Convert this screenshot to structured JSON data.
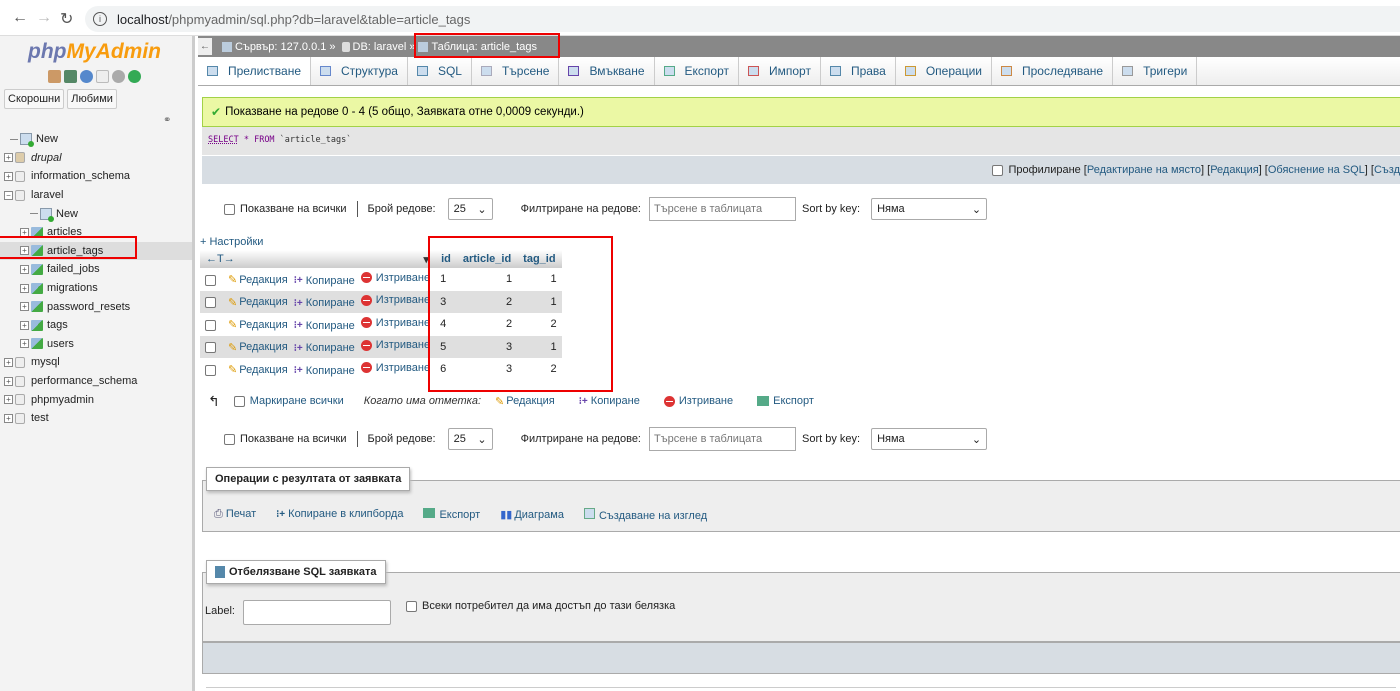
{
  "browser": {
    "url_host": "localhost",
    "url_path": "/phpmyadmin/sql.php?db=laravel&table=article_tags"
  },
  "sidebar": {
    "logo_php": "php",
    "logo_myadmin": "MyAdmin",
    "recent_button": "Скорошни",
    "favorites_button": "Любими",
    "tree": [
      {
        "label": "New",
        "type": "new",
        "level": 0
      },
      {
        "label": "drupal",
        "type": "db",
        "level": 0,
        "italic": true
      },
      {
        "label": "information_schema",
        "type": "db",
        "level": 0
      },
      {
        "label": "laravel",
        "type": "db",
        "level": 0,
        "expanded": true
      },
      {
        "label": "New",
        "type": "new",
        "level": 1
      },
      {
        "label": "articles",
        "type": "table",
        "level": 1
      },
      {
        "label": "article_tags",
        "type": "table",
        "level": 1,
        "selected": true
      },
      {
        "label": "failed_jobs",
        "type": "table",
        "level": 1
      },
      {
        "label": "migrations",
        "type": "table",
        "level": 1
      },
      {
        "label": "password_resets",
        "type": "table",
        "level": 1
      },
      {
        "label": "tags",
        "type": "table",
        "level": 1
      },
      {
        "label": "users",
        "type": "table",
        "level": 1
      },
      {
        "label": "mysql",
        "type": "db",
        "level": 0
      },
      {
        "label": "performance_schema",
        "type": "db",
        "level": 0
      },
      {
        "label": "phpmyadmin",
        "type": "db",
        "level": 0
      },
      {
        "label": "test",
        "type": "db",
        "level": 0
      }
    ]
  },
  "breadcrumb": {
    "server": "Сървър: 127.0.0.1",
    "sep": "»",
    "db": "DB: laravel",
    "table": "Таблица: article_tags"
  },
  "tabs": [
    {
      "label": "Прелистване",
      "icon": "browse-icon",
      "active": true
    },
    {
      "label": "Структура",
      "icon": "structure-icon"
    },
    {
      "label": "SQL",
      "icon": "sql-icon"
    },
    {
      "label": "Търсене",
      "icon": "search-icon"
    },
    {
      "label": "Вмъкване",
      "icon": "insert-icon"
    },
    {
      "label": "Експорт",
      "icon": "export-icon"
    },
    {
      "label": "Импорт",
      "icon": "import-icon"
    },
    {
      "label": "Права",
      "icon": "privileges-icon"
    },
    {
      "label": "Операции",
      "icon": "wrench-icon"
    },
    {
      "label": "Проследяване",
      "icon": "eye-icon"
    },
    {
      "label": "Тригери",
      "icon": "triggers-icon"
    }
  ],
  "message": {
    "success": "Показване на редове 0 - 4 (5 общо, Заявката отне 0,0009 секунди.)"
  },
  "sql": {
    "select": "SELECT",
    "star": " * ",
    "from": "FROM",
    "table": " `article_tags`"
  },
  "profiling": {
    "label": "Профилиране",
    "links_open": "[",
    "inline_edit": "Редактиране на място",
    "edit": "Редакция",
    "explain": "Обяснение на SQL",
    "create": "Създ"
  },
  "nav": {
    "show_all": "Показване на всички",
    "rows_label": "Брой редове:",
    "rows_value": "25",
    "filter_label": "Филтриране на редове:",
    "filter_placeholder": "Търсене в таблицата",
    "sort_label": "Sort by key:",
    "sort_value": "Няма"
  },
  "settings_link": "+ Настройки",
  "columns_arrows": "←T→",
  "table": {
    "headers": [
      "id",
      "article_id",
      "tag_id"
    ],
    "row_actions": {
      "edit": "Редакция",
      "copy": "Копиране",
      "delete": "Изтриване"
    },
    "rows": [
      {
        "id": "1",
        "article_id": "1",
        "tag_id": "1"
      },
      {
        "id": "3",
        "article_id": "2",
        "tag_id": "1"
      },
      {
        "id": "4",
        "article_id": "2",
        "tag_id": "2"
      },
      {
        "id": "5",
        "article_id": "3",
        "tag_id": "1"
      },
      {
        "id": "6",
        "article_id": "3",
        "tag_id": "2"
      }
    ]
  },
  "bulk": {
    "check_all": "Маркиране всички",
    "with_selected": "Когато има отметка:",
    "edit": "Редакция",
    "copy": "Копиране",
    "delete": "Изтриване",
    "export": "Експорт"
  },
  "query_ops": {
    "legend": "Операции с резултата от заявката",
    "print": "Печат",
    "copy_clipboard": "Копиране в клипборда",
    "export": "Експорт",
    "chart": "Диаграма",
    "create_view": "Създаване на изглед"
  },
  "bookmark": {
    "legend": "Отбелязване SQL заявката",
    "label": "Label:",
    "label_value": "",
    "shared": "Всеки потребител да има достъп до тази белязка"
  }
}
